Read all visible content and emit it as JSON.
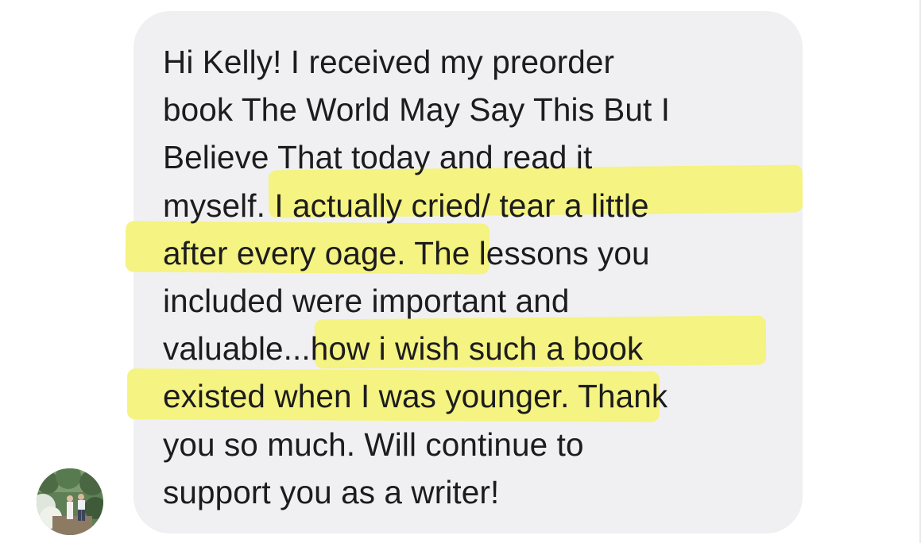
{
  "conversation": {
    "message": {
      "lines": [
        "Hi Kelly! I received my preorder",
        "book The World May Say This But I",
        "Believe That today and read it",
        "myself. I actually cried/ tear a little",
        "after every oage. The lessons you",
        "included were important and",
        "valuable...how i wish such a book",
        "existed when I was younger. Thank",
        "you so much. Will continue to",
        "support you as a writer!"
      ],
      "highlighted_passages": [
        ". I actually cried/ tear a little after every oage.",
        "...how i wish such a book existed when I was younger."
      ]
    },
    "sender_avatar": {
      "icon": "avatar-photo-couple-garden"
    }
  },
  "colors": {
    "bubble": "#f0f0f3",
    "highlight": "#f4f27a",
    "text": "#1c1c1e"
  }
}
